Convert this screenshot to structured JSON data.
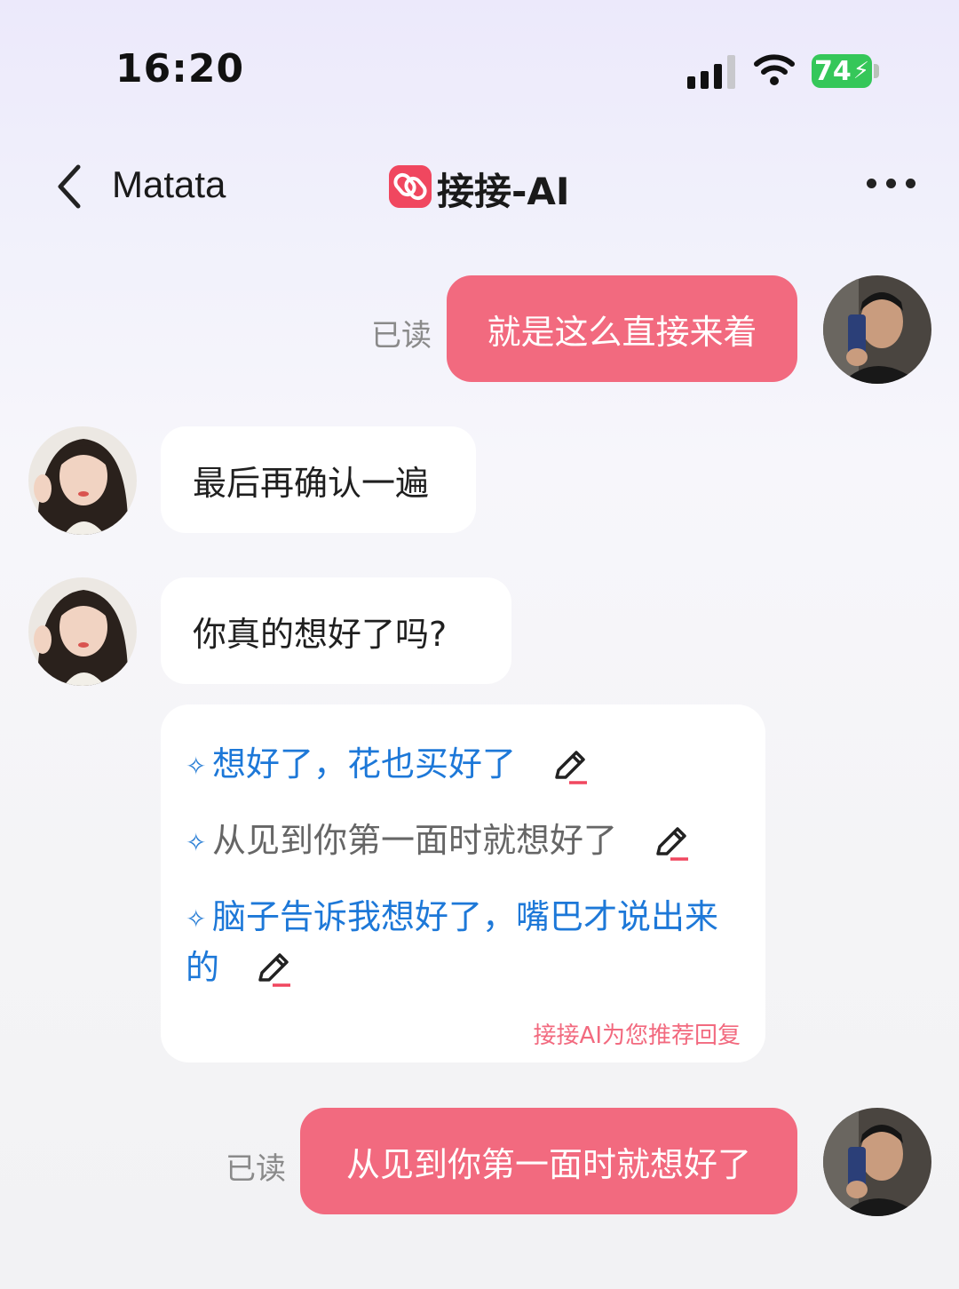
{
  "status_bar": {
    "time": "16:20",
    "battery": "74"
  },
  "nav": {
    "contact_name": "Matata",
    "app_title": "接接-AI",
    "back_icon": "chevron-left-icon",
    "more_icon": "more-dots-icon"
  },
  "messages": [
    {
      "side": "out",
      "text": "就是这么直接来着",
      "read_label": "已读"
    },
    {
      "side": "in",
      "text": "最后再确认一遍"
    },
    {
      "side": "in",
      "text": "你真的想好了吗?"
    },
    {
      "side": "out",
      "text": "从见到你第一面时就想好了",
      "read_label": "已读"
    }
  ],
  "recommendations": {
    "items": [
      {
        "text": "想好了，花也买好了"
      },
      {
        "text": "从见到你第一面时就想好了"
      },
      {
        "text": "脑子告诉我想好了，嘴巴才说出来的"
      }
    ],
    "footer": "接接AI为您推荐回复"
  },
  "colors": {
    "accent": "#f26a7f",
    "suggestion_blue": "#1d78d8",
    "suggestion_gray": "#666666",
    "battery_green": "#35c759"
  }
}
